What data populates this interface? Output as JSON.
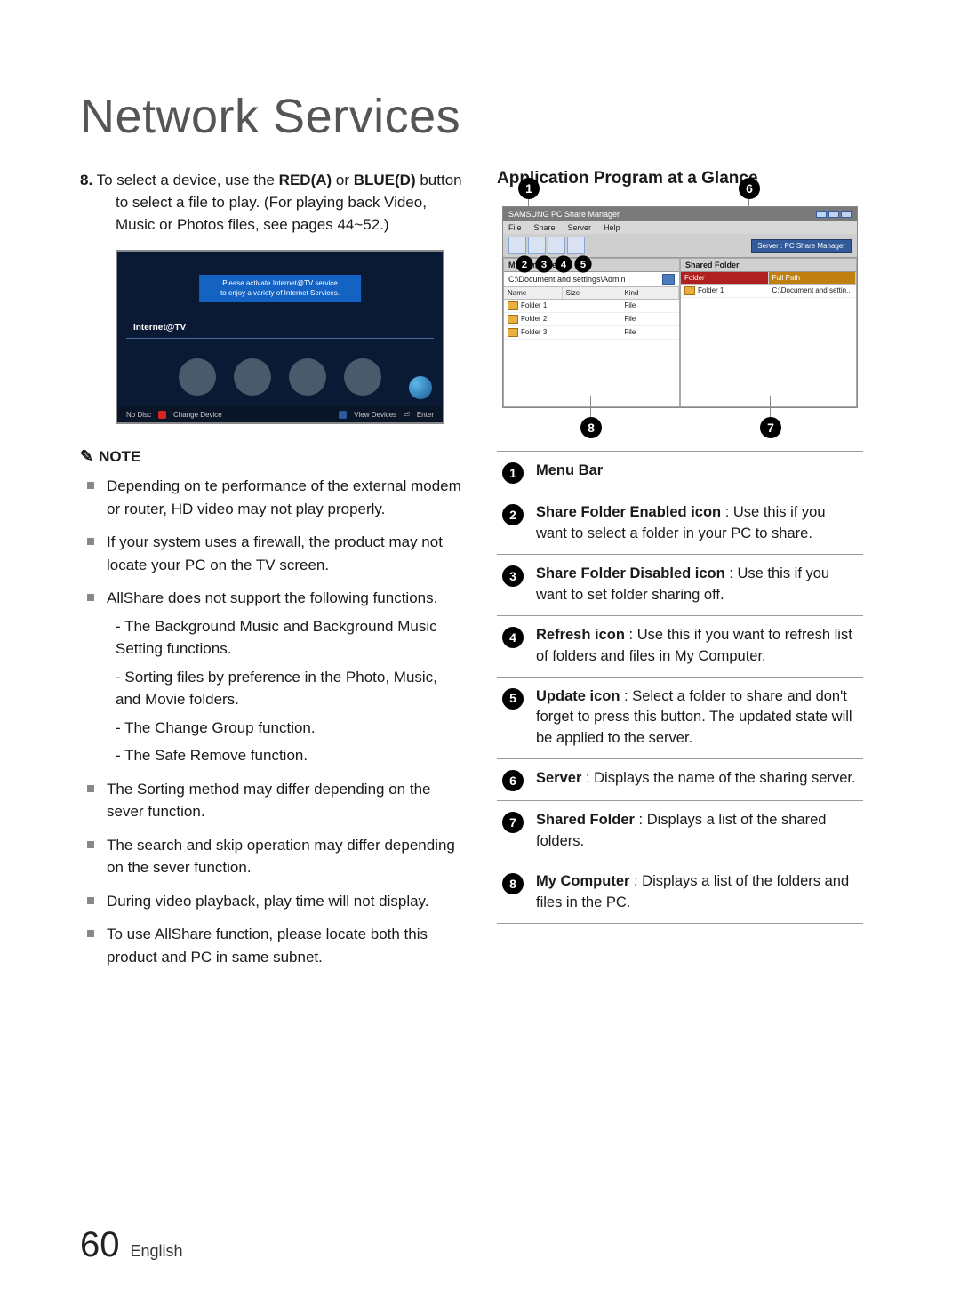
{
  "page": {
    "title": "Network Services",
    "number": "60",
    "language": "English"
  },
  "left": {
    "step_num": "8.",
    "step_text_1": "To select a device, use the ",
    "step_red": "RED(A)",
    "step_text_2": " or ",
    "step_blue": "BLUE(D)",
    "step_text_3": " button to select a file to play. (For playing back Video, Music or Photos files, see pages 44~52.)",
    "note_label": "NOTE",
    "notes": [
      "Depending on te performance of the external modem or router, HD video may not play properly.",
      "If your system uses a firewall, the product may not locate your PC on the TV screen.",
      "AllShare does not support the following functions.",
      "The Sorting method may differ depending on the sever function.",
      "The search and skip operation may differ depending on the sever function.",
      "During video playback, play time will not display.",
      "To use AllShare function, please locate both this product and PC in same subnet."
    ],
    "subnotes": [
      "The Background Music and Background Music Setting functions.",
      "Sorting files by preference in the Photo, Music, and Movie folders.",
      "The Change Group function.",
      "The Safe Remove function."
    ]
  },
  "tv": {
    "banner_l1": "Please activate Internet@TV service",
    "banner_l2": "to enjoy a variety of Internet Services.",
    "label": "Internet@TV",
    "footer_nodisc": "No Disc",
    "footer_change": "Change Device",
    "footer_view": "View Devices",
    "footer_enter": "Enter"
  },
  "right": {
    "heading": "Application Program at a Glance"
  },
  "app": {
    "title": "SAMSUNG PC Share Manager",
    "menus": [
      "File",
      "Share",
      "Server",
      "Help"
    ],
    "server_status": "Server : PC Share Manager",
    "left_pane_head": "My Computer",
    "path": "C:\\Document and settings\\Admin",
    "cols_left": [
      "Name",
      "Size",
      "Kind"
    ],
    "rows_left": [
      [
        "Folder 1",
        "",
        "File"
      ],
      [
        "Folder 2",
        "",
        "File"
      ],
      [
        "Folder 3",
        "",
        "File"
      ]
    ],
    "right_pane_head": "Shared Folder",
    "cols_right": [
      "Folder",
      "Full Path"
    ],
    "rows_right": [
      [
        "Folder 1",
        "C:\\Document and settin.."
      ]
    ]
  },
  "legend": [
    {
      "bold": "Menu Bar",
      "rest": ""
    },
    {
      "bold": "Share Folder Enabled icon",
      "rest": " : Use this if you want to select a folder in your PC to share."
    },
    {
      "bold": "Share Folder Disabled icon",
      "rest": " : Use this if you want to set folder sharing off."
    },
    {
      "bold": "Refresh icon",
      "rest": " : Use this if you want to refresh list of folders and files in My Computer."
    },
    {
      "bold": "Update icon",
      "rest": " : Select a folder to share and don't forget to press this button. The updated state will be applied to the server."
    },
    {
      "bold": "Server",
      "rest": " : Displays the name of the sharing server."
    },
    {
      "bold": "Shared Folder",
      "rest": " : Displays a list of the shared folders."
    },
    {
      "bold": "My Computer",
      "rest": " : Displays a list of the folders and files in the PC."
    }
  ]
}
